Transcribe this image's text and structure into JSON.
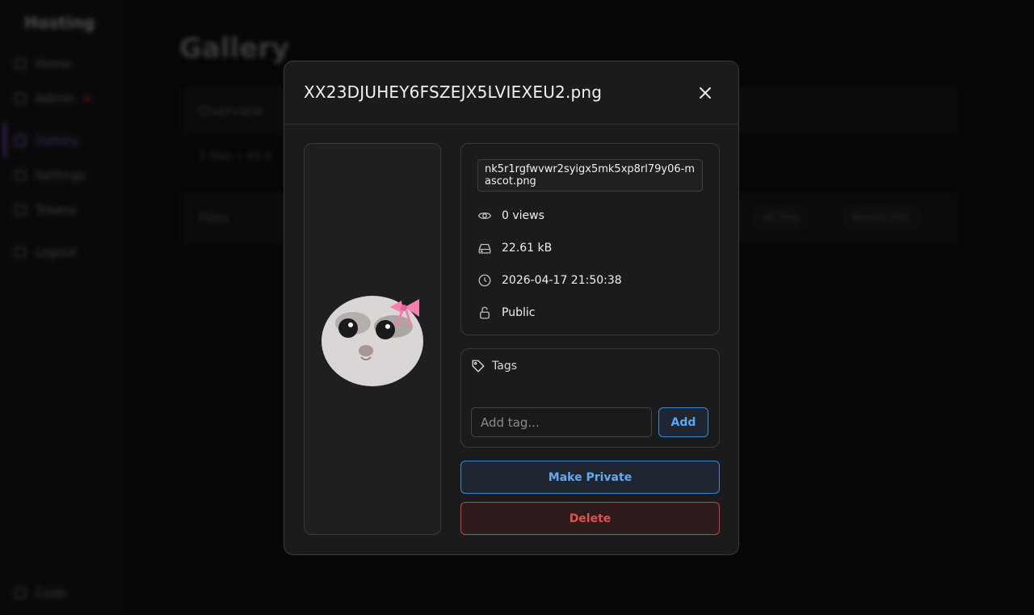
{
  "sidebar": {
    "brand": "Hosting",
    "items": [
      {
        "label": "Home",
        "icon": "home-icon"
      },
      {
        "label": "Admin",
        "icon": "shield-icon"
      },
      {
        "label": "Gallery",
        "icon": "image-icon"
      },
      {
        "label": "Settings",
        "icon": "gear-icon"
      },
      {
        "label": "Tokens",
        "icon": "key-icon"
      },
      {
        "label": "Logout",
        "icon": "logout-icon"
      }
    ],
    "footer": "Code"
  },
  "main": {
    "title": "Gallery",
    "overview_label": "Overview",
    "stats_text": "2 files • 45.0",
    "files_label": "Files",
    "filter_all": "All files",
    "sort_label": "Newest first"
  },
  "modal": {
    "title": "XX23DJUHEY6FSZEJX5LVIEXEU2.png",
    "original_name": "nk5r1rgfwvwr2syigx5mk5xp8rl79y06-mascot.png",
    "views": "0 views",
    "size": "22.61 kB",
    "date": "2026-04-17 21:50:38",
    "visibility": "Public",
    "tags_label": "Tags",
    "tag_placeholder": "Add tag...",
    "add_label": "Add",
    "make_private_label": "Make Private",
    "delete_label": "Delete"
  },
  "colors": {
    "accent_blue": "#5aa7ee",
    "danger_red": "#e0524a",
    "nav_active": "#6a4fa0"
  }
}
